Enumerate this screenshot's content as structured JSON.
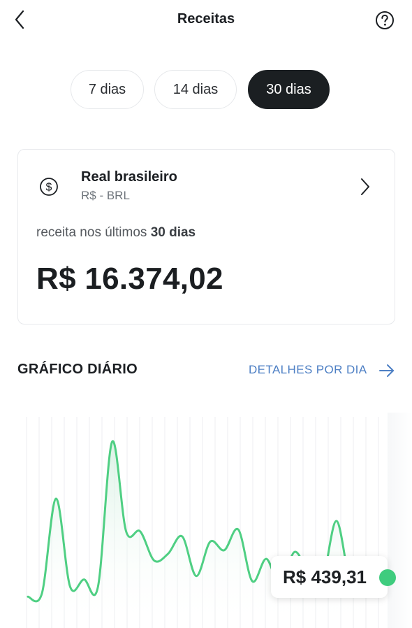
{
  "header": {
    "title": "Receitas",
    "back_icon": "chevron-left-icon",
    "help_icon": "help-circle-icon"
  },
  "periods": [
    {
      "label": "7 dias",
      "active": false
    },
    {
      "label": "14 dias",
      "active": false
    },
    {
      "label": "30 dias",
      "active": true
    }
  ],
  "currency_card": {
    "icon": "dollar-circle-icon",
    "name": "Real brasileiro",
    "code": "R$ - BRL",
    "caption_prefix": "receita nos últimos",
    "caption_period": "30 dias",
    "total": "R$ 16.374,02"
  },
  "daily_chart": {
    "title": "GRÁFICO DIÁRIO",
    "details_link": "DETALHES POR DIA",
    "tooltip_value": "R$ 439,31",
    "line_color": "#4fcf83"
  },
  "chart_data": {
    "type": "area",
    "values": [
      6,
      8,
      63,
      12,
      16,
      12,
      96,
      44,
      44,
      27,
      31,
      41,
      18,
      38,
      33,
      45,
      15,
      28,
      12,
      32,
      20,
      16,
      50,
      14,
      14
    ],
    "grid": true,
    "highlighted_value": "R$ 439,31"
  },
  "colors": {
    "accent_dark": "#1b1f22",
    "link_blue": "#4d7fc4",
    "chart_green": "#4fcf83"
  }
}
